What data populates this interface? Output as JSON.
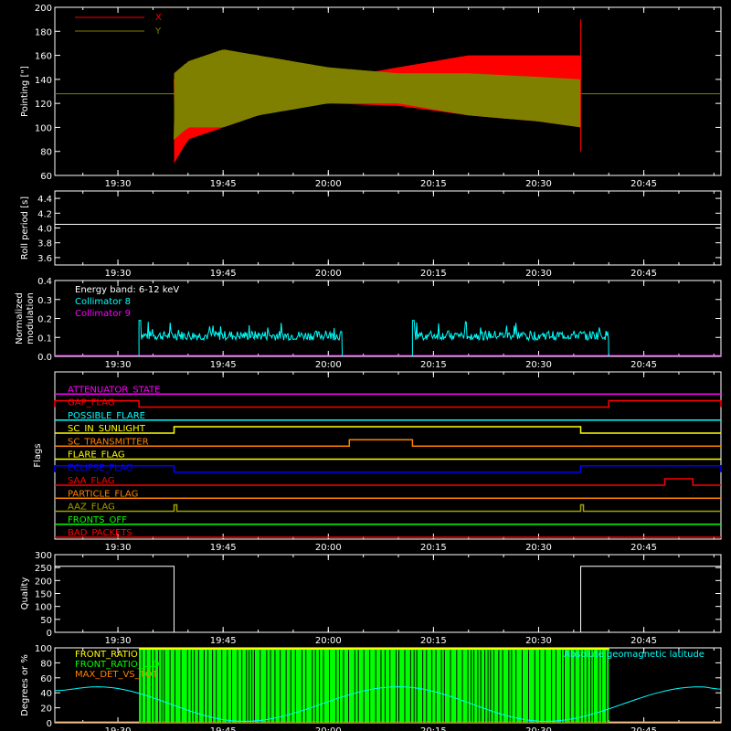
{
  "time_axis": {
    "ticks": [
      "19:30",
      "19:45",
      "20:00",
      "20:15",
      "20:30",
      "20:45"
    ],
    "start": "19:21",
    "end": "20:56"
  },
  "colors": {
    "x": "#ff0000",
    "y": "#808000",
    "white": "#ffffff",
    "cyan": "#00ffff",
    "magenta": "#ff00ff",
    "green": "#00ff00",
    "orange": "#ff8000",
    "yellow": "#ffff00",
    "blue": "#0000ff",
    "red": "#ff0000",
    "olive": "#a0a000"
  },
  "chart_data": [
    {
      "id": "pointing",
      "type": "line",
      "ylabel": "Pointing [\"]",
      "ylim": [
        60,
        200
      ],
      "yticks": [
        60,
        80,
        100,
        120,
        140,
        160,
        180,
        200
      ],
      "legend": [
        "X",
        "Y"
      ],
      "series": [
        {
          "name": "X",
          "t": [
            "19:38",
            "19:40",
            "19:45",
            "19:50",
            "19:55",
            "20:00",
            "20:10",
            "20:20",
            "20:30",
            "20:36"
          ],
          "upper": [
            140,
            145,
            150,
            145,
            140,
            140,
            150,
            160,
            160,
            160
          ],
          "lower": [
            70,
            90,
            100,
            110,
            118,
            120,
            118,
            110,
            105,
            100
          ]
        },
        {
          "name": "Y",
          "t": [
            "19:38",
            "19:40",
            "19:45",
            "19:50",
            "19:55",
            "20:00",
            "20:10",
            "20:20",
            "20:30",
            "20:36"
          ],
          "upper": [
            145,
            155,
            165,
            160,
            155,
            150,
            145,
            145,
            142,
            140
          ],
          "lower": [
            90,
            100,
            100,
            110,
            115,
            120,
            120,
            110,
            105,
            100
          ]
        }
      ],
      "reference_line": 128
    },
    {
      "id": "roll",
      "type": "line",
      "ylabel": "Roll period [s]",
      "ylim": [
        3.5,
        4.5
      ],
      "yticks": [
        3.6,
        3.8,
        4.0,
        4.2,
        4.4
      ],
      "value": 4.05
    },
    {
      "id": "modulation",
      "type": "line",
      "ylabel": "Normalized modulation",
      "ylim": [
        0,
        0.4
      ],
      "yticks": [
        0.0,
        0.1,
        0.2,
        0.3,
        0.4
      ],
      "annotations": [
        "Energy band: 6-12 keV",
        "Collimator 8",
        "Collimator 9"
      ],
      "segments": [
        [
          "19:33",
          "20:02"
        ],
        [
          "20:12",
          "20:40"
        ]
      ],
      "mean": 0.11
    },
    {
      "id": "flags",
      "type": "line",
      "ylabel": "Flags",
      "flags": [
        {
          "name": "ATTENUATOR_STATE",
          "color": "#ff00ff",
          "high": []
        },
        {
          "name": "GAP_FLAG",
          "color": "#ff0000",
          "high": [
            [
              "19:21",
              "19:33"
            ],
            [
              "20:40",
              "20:56"
            ]
          ]
        },
        {
          "name": "POSSIBLE_FLARE",
          "color": "#00ffff",
          "high": []
        },
        {
          "name": "SC_IN_SUNLIGHT",
          "color": "#ffff00",
          "high": [
            [
              "19:38",
              "20:36"
            ]
          ]
        },
        {
          "name": "SC_TRANSMITTER",
          "color": "#ff8000",
          "high": [
            [
              "20:03",
              "20:12"
            ]
          ]
        },
        {
          "name": "FLARE_FLAG",
          "color": "#ffff00",
          "high": []
        },
        {
          "name": "ECLIPSE_FLAG",
          "color": "#0000ff",
          "high": [
            [
              "19:21",
              "19:38"
            ],
            [
              "20:36",
              "20:56"
            ]
          ]
        },
        {
          "name": "SAA_FLAG",
          "color": "#ff0000",
          "high": [
            [
              "20:48",
              "20:52"
            ]
          ]
        },
        {
          "name": "PARTICLE_FLAG",
          "color": "#ff8000",
          "high": []
        },
        {
          "name": "AAZ_FLAG",
          "color": "#a0a000",
          "high": [
            [
              "19:38",
              "19:38"
            ],
            [
              "20:36",
              "20:36"
            ]
          ]
        },
        {
          "name": "FRONTS_OFF",
          "color": "#00ff00",
          "high": []
        },
        {
          "name": "BAD_PACKETS",
          "color": "#ff0000",
          "high": []
        }
      ]
    },
    {
      "id": "quality",
      "type": "line",
      "ylabel": "Quality",
      "ylim": [
        0,
        300
      ],
      "yticks": [
        0,
        50,
        100,
        150,
        200,
        250,
        300
      ],
      "steps": [
        [
          "19:21",
          255
        ],
        [
          "19:38",
          0
        ],
        [
          "20:36",
          255
        ],
        [
          "20:56",
          255
        ]
      ]
    },
    {
      "id": "ratios",
      "type": "line",
      "ylabel": "Degrees or %",
      "ylim": [
        0,
        100
      ],
      "yticks": [
        0,
        20,
        40,
        60,
        80,
        100
      ],
      "legend": [
        "FRONT_RATIO",
        "FRONT_RATIO_LLD",
        "MAX_DET_VS_TOT"
      ],
      "right_label": "Absolute geomagnetic latitude",
      "green_block": [
        "19:33",
        "20:40"
      ],
      "latitude": {
        "t": [
          "19:21",
          "19:27",
          "19:48",
          "20:10",
          "20:31",
          "20:53",
          "20:56"
        ],
        "v": [
          43,
          48,
          2,
          48,
          2,
          48,
          45
        ]
      }
    }
  ]
}
